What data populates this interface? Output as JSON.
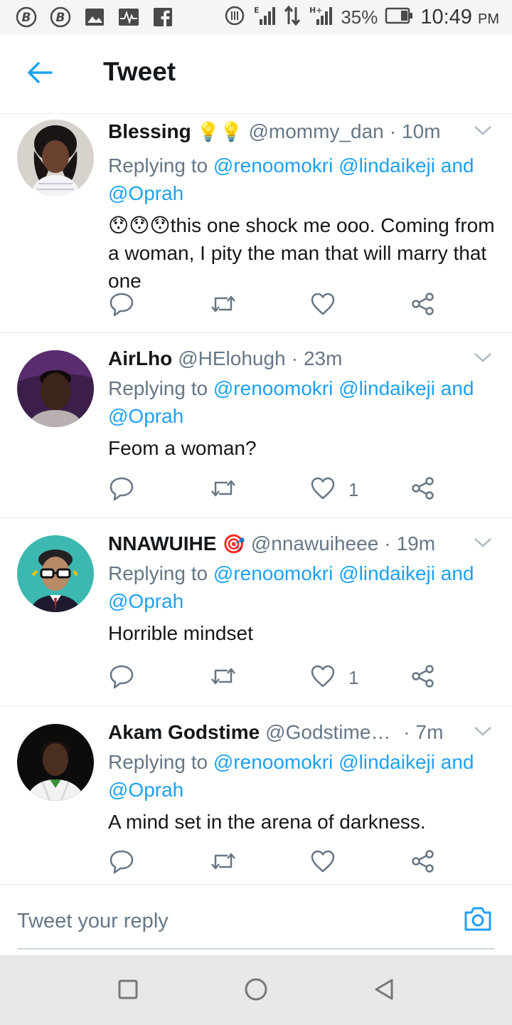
{
  "status_bar": {
    "left_icons": [
      "bbm-icon",
      "bbm-icon",
      "gallery-icon",
      "activity-icon",
      "facebook-icon"
    ],
    "battery": "35%",
    "time": "10:49",
    "ampm": "PM",
    "network_1": "E",
    "network_2": "H+"
  },
  "header": {
    "title": "Tweet"
  },
  "tweets": [
    {
      "name": "Blessing",
      "emoji": "💡💡",
      "handle": "@mommy_dan",
      "time": "10m",
      "replying_prefix": "Replying to",
      "mention_1": "@renoomokri",
      "mention_2": "@lindaikeji",
      "and": "and",
      "mention_3": "@Oprah",
      "text": "😯😯😯this one shock me ooo. Coming from a woman, I pity the man that will marry that one",
      "likes": ""
    },
    {
      "name": "AirLho",
      "emoji": "",
      "handle": "@HElohugh",
      "time": "23m",
      "replying_prefix": "Replying to",
      "mention_1": "@renoomokri",
      "mention_2": "@lindaikeji",
      "and": "and",
      "mention_3": "@Oprah",
      "text": "Feom a woman?",
      "likes": "1"
    },
    {
      "name": "NNAWUIHE",
      "emoji": "🎯",
      "handle": "@nnawuiheee",
      "time": "19m",
      "replying_prefix": "Replying to",
      "mention_1": "@renoomokri",
      "mention_2": "@lindaikeji",
      "and": "and",
      "mention_3": "@Oprah",
      "text": "Horrible mindset",
      "likes": "1"
    },
    {
      "name": "Akam Godstime",
      "emoji": "",
      "handle": "@GodstimeA...",
      "time": "7m",
      "replying_prefix": "Replying to",
      "mention_1": "@renoomokri",
      "mention_2": "@lindaikeji",
      "and": "and",
      "mention_3": "@Oprah",
      "text": "A mind set in the arena of darkness.",
      "likes": ""
    }
  ],
  "reply_bar": {
    "placeholder": "Tweet your reply"
  },
  "colors": {
    "accent": "#1da1f2",
    "secondary_text": "#657786",
    "primary_text": "#14171a",
    "divider": "#e1e8ed",
    "status_bar_bg": "#f5f5f5",
    "nav_bar_bg": "#e8e8e8"
  }
}
